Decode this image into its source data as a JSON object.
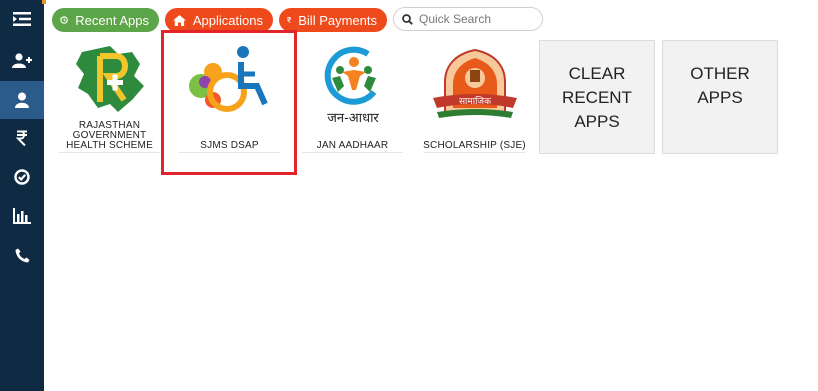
{
  "colors": {
    "sidebar_bg": "#0f2a43",
    "sidebar_active": "#2a5b8a",
    "recent_apps_green": "#5ca548",
    "action_orange": "#ee4a1c",
    "highlight_red": "#e2232a",
    "grey_tile": "#f2f2f2"
  },
  "sidebar": {
    "items": [
      {
        "icon": "menu-toggle-icon",
        "active": false
      },
      {
        "icon": "add-user-icon",
        "active": false
      },
      {
        "icon": "user-icon",
        "active": true
      },
      {
        "icon": "rupee-icon",
        "active": false
      },
      {
        "icon": "check-circle-icon",
        "active": false
      },
      {
        "icon": "bar-chart-icon",
        "active": false
      },
      {
        "icon": "phone-icon",
        "active": false
      }
    ]
  },
  "topbar": {
    "recent_apps_label": "Recent Apps",
    "recent_apps_icon": "history-icon",
    "applications_label": "Applications",
    "applications_icon": "home-icon",
    "bill_payments_label": "Bill Payments",
    "bill_payments_icon": "rupee-icon",
    "search": {
      "placeholder": "Quick Search",
      "value": "",
      "icon": "search-icon"
    }
  },
  "apps": [
    {
      "label": "RAJASTHAN GOVERNMENT HEALTH SCHEME",
      "logo": "rghs-logo",
      "highlighted": false
    },
    {
      "label": "SJMS DSAP",
      "logo": "wheelchair-logo",
      "highlighted": true
    },
    {
      "label": "JAN AADHAAR",
      "logo": "jan-aadhaar-logo",
      "logo_text": "जन-आधार",
      "highlighted": false
    },
    {
      "label": "SCHOLARSHIP (SJE)",
      "logo": "emblem-logo",
      "logo_text": "सामाजिक",
      "highlighted": false
    }
  ],
  "actions": {
    "clear_recent_apps": "CLEAR RECENT APPS",
    "other_apps": "OTHER APPS"
  }
}
